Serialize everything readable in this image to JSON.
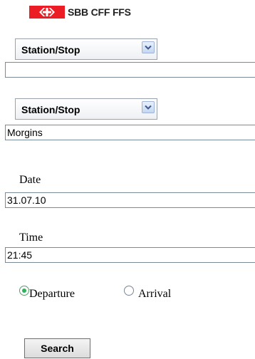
{
  "brand": {
    "name": "SBB CFF FFS",
    "color": "#ec1c24",
    "logo_icon": "sbb-arrows-icon"
  },
  "from": {
    "type_select": "Station/Stop",
    "value": ""
  },
  "to": {
    "type_select": "Station/Stop",
    "value": "Morgins"
  },
  "date": {
    "label": "Date",
    "value": "31.07.10"
  },
  "time": {
    "label": "Time",
    "value": "21:45"
  },
  "mode": {
    "options": [
      {
        "label": "Departure",
        "selected": true
      },
      {
        "label": "Arrival",
        "selected": false
      }
    ]
  },
  "actions": {
    "search_label": "Search"
  }
}
